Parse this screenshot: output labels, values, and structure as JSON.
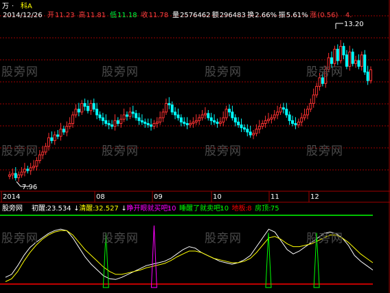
{
  "header": {
    "stock_name_prefix": "万",
    "stock_name": "科A",
    "stock_name_marker": "·",
    "stats_line": [
      {
        "label": "",
        "value": "2014/12/26",
        "color": "#ffffff"
      },
      {
        "label": "开",
        "value": "11.23",
        "color": "#ff4040"
      },
      {
        "label": "高",
        "value": "11.81",
        "color": "#ff4040"
      },
      {
        "label": "低",
        "value": "11.18",
        "color": "#00ff40"
      },
      {
        "label": "收",
        "value": "11.78",
        "color": "#ff4040"
      },
      {
        "label": "量",
        "value": "2576462",
        "color": "#ffffff"
      },
      {
        "label": "额",
        "value": "296483",
        "color": "#ffffff"
      },
      {
        "label": "换",
        "value": "2.66%",
        "color": "#ffffff"
      },
      {
        "label": "振",
        "value": "5.61%",
        "color": "#ffffff"
      },
      {
        "label": "涨",
        "value": "(0.56)",
        "color": "#ff4040"
      },
      {
        "label": "",
        "value": "4.",
        "color": "#ff4040"
      }
    ]
  },
  "indicator_header": {
    "name": "股旁网",
    "items": [
      {
        "label": "初醒:",
        "value": "23.534",
        "color": "#ffffff",
        "arrow": "↓"
      },
      {
        "label": "清醒:",
        "value": "32.527",
        "color": "#ffff00",
        "arrow": "↓"
      },
      {
        "label": "睁开眼就买吧:",
        "value": "10",
        "color": "#ff00ff",
        "arrow": ""
      },
      {
        "label": "睡醒了就卖吧:",
        "value": "10",
        "color": "#00ff00",
        "arrow": ""
      },
      {
        "label": "地板:",
        "value": "8",
        "color": "#ff0000",
        "arrow": ""
      },
      {
        "label": "房顶:",
        "value": "75",
        "color": "#00ff00",
        "arrow": ""
      }
    ]
  },
  "watermark": "股旁网",
  "colors": {
    "up": "#ff3232",
    "down": "#00ffff",
    "grid": "#a00000",
    "fast_line": "#ffffff",
    "slow_line": "#ffff00",
    "buy_spike": "#ff00ff",
    "sell_spike": "#00ff00",
    "floor_line": "#ff0000",
    "roof_line": "#00ff00"
  },
  "chart_data": [
    {
      "type": "candlestick",
      "title": "",
      "x_tick_labels": [
        "2014",
        "08",
        "09",
        "10",
        "11",
        "12"
      ],
      "price_annotations": {
        "high": "13.20",
        "low": "7.96"
      },
      "ylim": [
        7.6,
        13.5
      ],
      "close_values": [
        8.1,
        8.15,
        8.0,
        8.1,
        8.2,
        8.3,
        8.25,
        8.35,
        8.4,
        8.6,
        8.8,
        8.9,
        9.1,
        9.4,
        9.3,
        9.5,
        9.45,
        9.7,
        9.6,
        9.8,
        9.9,
        10.2,
        10.4,
        10.3,
        10.6,
        10.5,
        10.35,
        10.6,
        10.4,
        10.2,
        10.1,
        10.0,
        9.9,
        9.85,
        9.8,
        10.0,
        9.9,
        10.05,
        10.2,
        10.15,
        10.3,
        10.25,
        10.1,
        10.0,
        9.95,
        9.9,
        9.85,
        9.8,
        9.9,
        9.95,
        10.1,
        10.3,
        10.6,
        10.55,
        10.3,
        10.2,
        10.1,
        9.95,
        9.9,
        9.85,
        9.9,
        9.95,
        10.0,
        10.1,
        10.2,
        10.25,
        10.1,
        10.0,
        9.95,
        9.9,
        9.95,
        10.1,
        10.4,
        10.3,
        10.1,
        9.95,
        9.85,
        9.75,
        9.7,
        9.6,
        9.5,
        9.55,
        9.7,
        9.8,
        9.9,
        10.0,
        10.05,
        10.1,
        10.2,
        10.3,
        10.45,
        10.4,
        10.2,
        10.0,
        9.9,
        9.85,
        9.95,
        10.1,
        10.2,
        10.4,
        10.6,
        10.9,
        11.2,
        11.5,
        11.3,
        11.8,
        12.2,
        12.0,
        12.5,
        12.1,
        12.6,
        12.3,
        11.9,
        12.4,
        12.0,
        12.1,
        11.9,
        12.3,
        11.7,
        11.4,
        11.78
      ],
      "series": [],
      "xlabel": "",
      "ylabel": ""
    },
    {
      "type": "line",
      "title": "",
      "ylim": [
        0,
        100
      ],
      "reference_lines": {
        "floor": 8,
        "roof": 75
      },
      "series": [
        {
          "name": "初醒",
          "values": [
            14,
            18,
            30,
            44,
            55,
            62,
            68,
            74,
            78,
            80,
            78,
            68,
            55,
            42,
            32,
            24,
            16,
            12,
            11,
            14,
            18,
            22,
            26,
            30,
            32,
            34,
            36,
            40,
            46,
            52,
            56,
            54,
            48,
            44,
            40,
            36,
            34,
            32,
            34,
            38,
            44,
            56,
            68,
            80,
            76,
            64,
            52,
            46,
            50,
            56,
            62,
            68,
            74,
            76,
            74,
            68,
            58,
            44,
            36,
            30,
            24
          ]
        },
        {
          "name": "清醒",
          "values": [
            8,
            12,
            22,
            36,
            48,
            58,
            66,
            72,
            76,
            78,
            78,
            72,
            62,
            52,
            44,
            36,
            28,
            22,
            18,
            18,
            20,
            22,
            24,
            27,
            29,
            31,
            33,
            37,
            42,
            46,
            50,
            50,
            48,
            44,
            40,
            38,
            36,
            34,
            34,
            36,
            40,
            48,
            58,
            68,
            70,
            66,
            60,
            56,
            56,
            58,
            60,
            64,
            68,
            72,
            72,
            68,
            62,
            54,
            46,
            40,
            34
          ]
        }
      ],
      "spikes": [
        {
          "x_index": 32,
          "value": 75,
          "kind": "睡醒了就卖吧"
        },
        {
          "x_index": 48,
          "value": 85,
          "kind": "睁开眼就买吧"
        },
        {
          "x_index": 86,
          "value": 75,
          "kind": "睡醒了就卖吧"
        },
        {
          "x_index": 102,
          "value": 75,
          "kind": "睡醒了就卖吧"
        }
      ],
      "xlabel": "",
      "ylabel": ""
    }
  ]
}
